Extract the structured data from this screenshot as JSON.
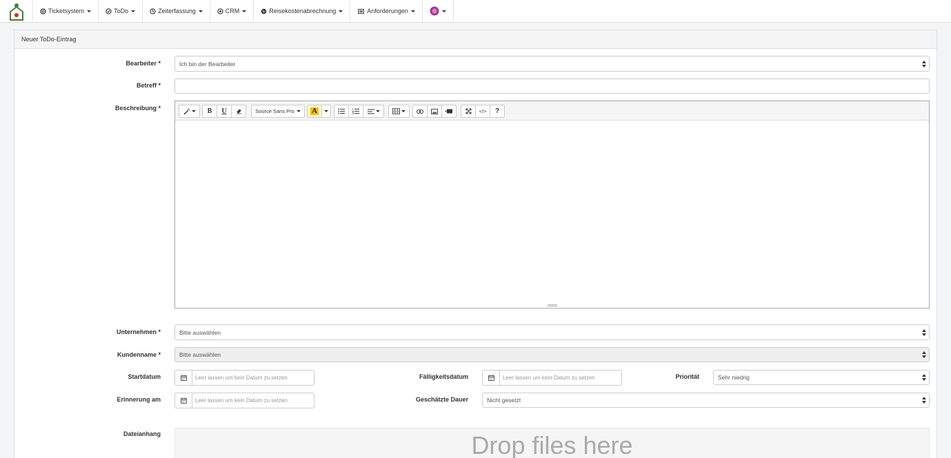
{
  "nav": {
    "items": [
      {
        "label": "Ticketsystem",
        "icon": "lifebuoy-icon"
      },
      {
        "label": "ToDo",
        "icon": "check-circle-icon"
      },
      {
        "label": "Zeiterfassung",
        "icon": "clock-icon"
      },
      {
        "label": "CRM",
        "icon": "dot-circle-icon"
      },
      {
        "label": "Reisekostenabrechnung",
        "icon": "globe-icon"
      },
      {
        "label": "Anforderungen",
        "icon": "list-alt-icon"
      }
    ],
    "user_icon": "user-avatar-icon"
  },
  "panel": {
    "title": "Neuer ToDo-Eintrag"
  },
  "form": {
    "bearbeiter_label": "Bearbeiter *",
    "bearbeiter_value": "Ich bin der Bearbeiter",
    "betreff_label": "Betreff *",
    "betreff_value": "",
    "beschreibung_label": "Beschreibung *",
    "editor_font": "Source Sans Pro",
    "unternehmen_label": "Unternehmen *",
    "unternehmen_value": "Bitte auswählen",
    "kundenname_label": "Kundenname *",
    "kundenname_value": "Bitte auswählen",
    "startdatum_label": "Startdatum",
    "startdatum_placeholder": "Leer lassen um kein Datum zu setzen",
    "faelligkeit_label": "Fälligkeitsdatum",
    "faelligkeit_placeholder": "Leer lassen um kein Datum zu setzen",
    "prioritaet_label": "Priorität",
    "prioritaet_value": "Sehr niedrig",
    "erinnerung_label": "Erinnerung am",
    "erinnerung_placeholder": "Leer lassen um kein Datum zu setzen",
    "dauer_label": "Geschätzte Dauer",
    "dauer_value": "Nicht gesetzt",
    "dateianhang_label": "Dateianhang",
    "dropzone_text": "Drop files here"
  },
  "colors": {
    "accent_yellow": "#f0c000",
    "logo_green": "#4a7c3a",
    "logo_red": "#c0392b"
  }
}
